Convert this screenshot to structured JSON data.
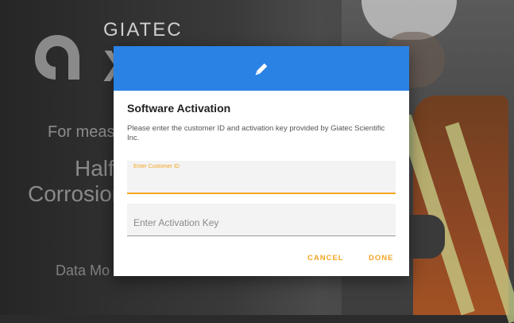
{
  "background": {
    "brand_name": "GIATEC",
    "brand_product": "X",
    "measure_text": "For meas",
    "half_text": "Half",
    "corrosion_text": "Corrosion",
    "data_text": "Data Mo"
  },
  "dialog": {
    "header_icon": "pencil-icon",
    "title": "Software Activation",
    "description": "Please enter the customer ID and activation key provided by Giatec Scientific Inc.",
    "customer_id": {
      "label": "Enter Customer ID",
      "value": ""
    },
    "activation_key": {
      "placeholder": "Enter Activation Key",
      "value": ""
    },
    "cancel_label": "CANCEL",
    "done_label": "DONE"
  },
  "colors": {
    "header": "#2a82e4",
    "accent": "#f5a623"
  }
}
